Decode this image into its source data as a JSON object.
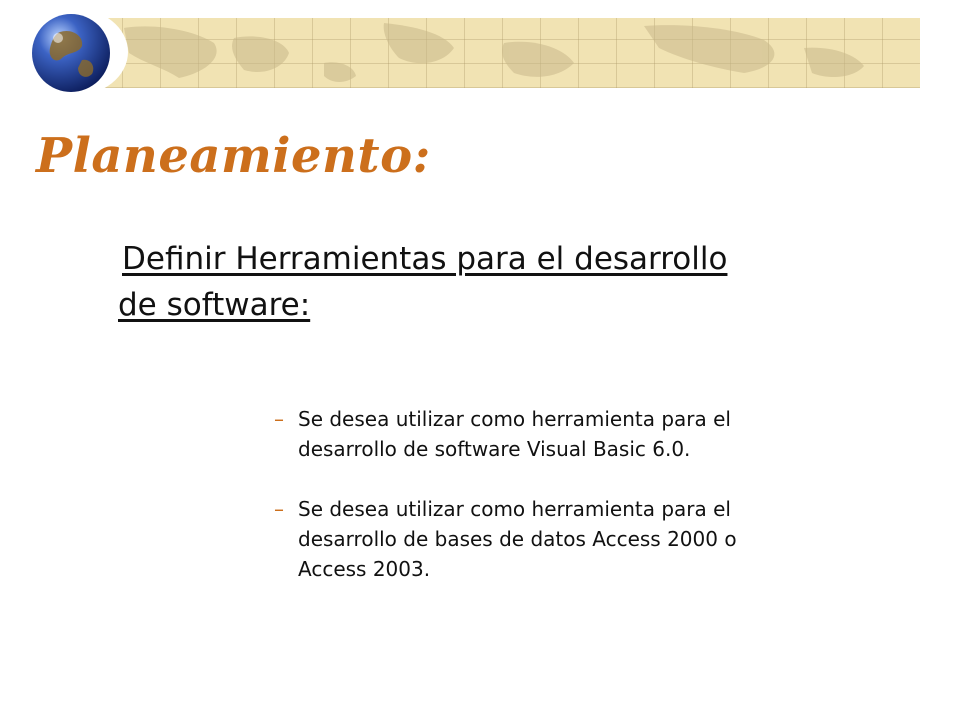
{
  "slide": {
    "title": "Planeamiento:",
    "subtitle_line1": "Definir Herramientas para el desarrollo",
    "subtitle_line2": "de software:",
    "bullet_glyph": "–",
    "bullets": [
      {
        "line1": "Se desea utilizar como herramienta para el",
        "line2": "desarrollo de software Visual Basic 6.0."
      },
      {
        "line1": "Se desea utilizar como herramienta para el",
        "line2": "desarrollo de bases de datos Access 2000 o",
        "line3": "Access 2003."
      }
    ]
  },
  "colors": {
    "title": "#cc6f1c",
    "banner": "#f1e3b3",
    "text": "#111111"
  },
  "icons": {
    "globe": "globe-icon",
    "banner": "world-map-banner"
  }
}
